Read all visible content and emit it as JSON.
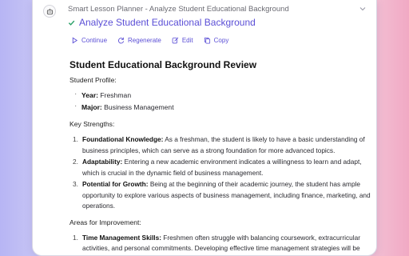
{
  "header": {
    "breadcrumb": "Smart Lesson Planner - Analyze Student Educational Background",
    "task_title": "Analyze Student Educational Background",
    "task_status": "completed"
  },
  "actions": {
    "continue_label": "Continue",
    "regenerate_label": "Regenerate",
    "edit_label": "Edit",
    "copy_label": "Copy"
  },
  "content": {
    "heading": "Student Educational Background Review",
    "profile_heading": "Student Profile:",
    "profile": [
      {
        "key": "Year:",
        "value": " Freshman"
      },
      {
        "key": "Major:",
        "value": " Business Management"
      }
    ],
    "strengths_heading": "Key Strengths:",
    "strengths": [
      {
        "num": "1.",
        "key": "Foundational Knowledge:",
        "text": " As a freshman, the student is likely to have a basic understanding of business principles, which can serve as a strong foundation for more advanced topics."
      },
      {
        "num": "2.",
        "key": "Adaptability:",
        "text": " Entering a new academic environment indicates a willingness to learn and adapt, which is crucial in the dynamic field of business management."
      },
      {
        "num": "3.",
        "key": "Potential for Growth:",
        "text": " Being at the beginning of their academic journey, the student has ample opportunity to explore various aspects of business management, including finance, marketing, and operations."
      }
    ],
    "improvement_heading": "Areas for Improvement:",
    "improvements": [
      {
        "num": "1.",
        "key": "Time Management Skills:",
        "text": " Freshmen often struggle with balancing coursework, extracurricular activities, and personal commitments. Developing effective time management strategies will be"
      }
    ]
  },
  "colors": {
    "accent": "#5b4fd6",
    "check": "#2fa36b"
  }
}
